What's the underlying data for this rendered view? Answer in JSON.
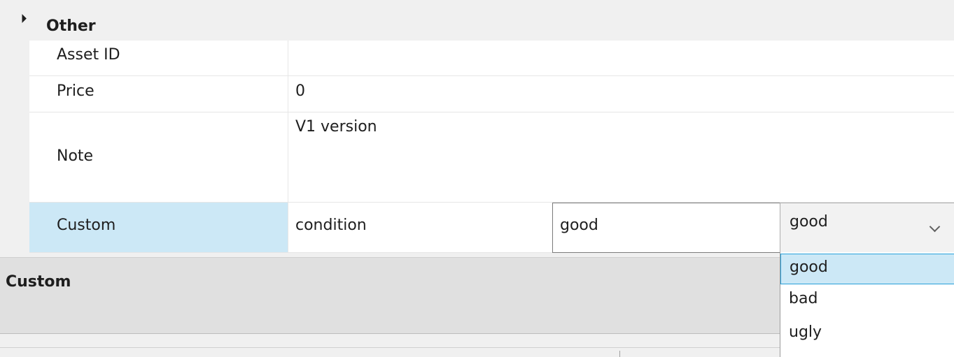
{
  "category": {
    "title": "Other"
  },
  "rows": [
    {
      "name": "Asset ID",
      "value": ""
    },
    {
      "name": "Price",
      "value": "0"
    },
    {
      "name": "Note",
      "value": "V1 version"
    }
  ],
  "custom_row": {
    "name": "Custom",
    "key": "condition",
    "value": "good",
    "combo_selected": "good"
  },
  "dropdown": {
    "options": [
      "good",
      "bad",
      "ugly"
    ],
    "highlighted": "good"
  },
  "description": {
    "title": "Custom"
  },
  "colors": {
    "selection": "#cce8f6",
    "selection_border": "#26a0da",
    "panel_bg": "#e0e0e0"
  },
  "icons": {
    "expand": "collapse-triangle-icon",
    "combo": "chevron-down-icon"
  }
}
